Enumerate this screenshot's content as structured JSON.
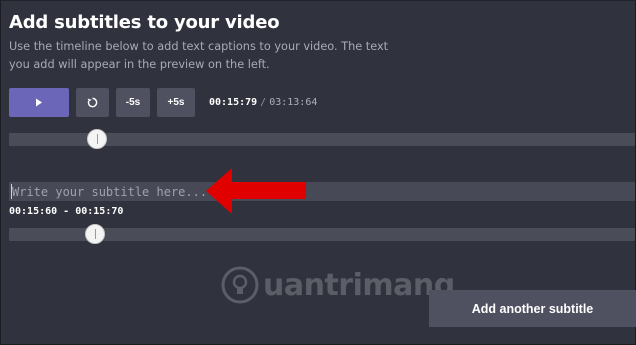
{
  "header": {
    "title": "Add subtitles to your video",
    "description": "Use the timeline below to add text captions to your video. The text you add will appear in the preview on the left."
  },
  "player": {
    "play_icon": "play-icon",
    "restart_icon": "restart-icon",
    "back_label": "-5s",
    "forward_label": "+5s",
    "current_time": "00:15:79",
    "separator": "/",
    "total_time": "03:13:64",
    "progress_fraction": 0.14
  },
  "subtitle": {
    "placeholder": "Write your subtitle here...",
    "value": "",
    "range_text": "00:15:60 - 00:15:70",
    "range_fraction": 0.14
  },
  "actions": {
    "add_label": "Add another subtitle"
  },
  "watermark": {
    "text": "uantrimang"
  },
  "colors": {
    "background": "#30323d",
    "play_button": "#6b66b8",
    "button": "#4f5160",
    "track": "#4a4c58",
    "annotation_arrow": "#e00000"
  }
}
